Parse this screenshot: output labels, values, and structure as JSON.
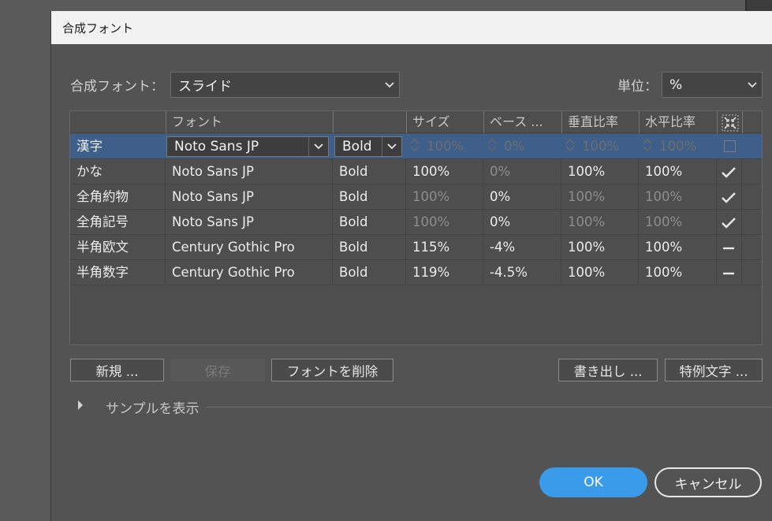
{
  "dialog": {
    "title": "合成フォント"
  },
  "composite": {
    "label": "合成フォント：",
    "value": "スライド"
  },
  "unit": {
    "label": "単位：",
    "value": "%"
  },
  "table": {
    "headers": {
      "font": "フォント",
      "size": "サイズ",
      "baseline": "ベース ...",
      "vscale": "垂直比率",
      "hscale": "水平比率"
    },
    "rows": [
      {
        "name": "漢字",
        "font": "Noto Sans JP",
        "style": "Bold",
        "size": "100%",
        "baseline": "0%",
        "vscale": "100%",
        "hscale": "100%",
        "mark": "checkbox"
      },
      {
        "name": "かな",
        "font": "Noto Sans JP",
        "style": "Bold",
        "size": "100%",
        "baseline": "0%",
        "vscale": "100%",
        "hscale": "100%",
        "mark": "check"
      },
      {
        "name": "全角約物",
        "font": "Noto Sans JP",
        "style": "Bold",
        "size": "100%",
        "baseline": "0%",
        "vscale": "100%",
        "hscale": "100%",
        "mark": "check"
      },
      {
        "name": "全角記号",
        "font": "Noto Sans JP",
        "style": "Bold",
        "size": "100%",
        "baseline": "0%",
        "vscale": "100%",
        "hscale": "100%",
        "mark": "check"
      },
      {
        "name": "半角欧文",
        "font": "Century Gothic Pro",
        "style": "Bold",
        "size": "115%",
        "baseline": "-4%",
        "vscale": "100%",
        "hscale": "100%",
        "mark": "dash"
      },
      {
        "name": "半角数字",
        "font": "Century Gothic Pro",
        "style": "Bold",
        "size": "119%",
        "baseline": "-4.5%",
        "vscale": "100%",
        "hscale": "100%",
        "mark": "dash"
      }
    ]
  },
  "buttons": {
    "new": "新規 ...",
    "save": "保存",
    "delete": "フォントを削除",
    "export": "書き出し ...",
    "exceptions": "特例文字 ...",
    "ok": "OK",
    "cancel": "キャンセル"
  },
  "sample": {
    "label": "サンプルを表示"
  },
  "colors": {
    "accent": "#3a9bea",
    "selection": "#3e5f8a",
    "dialog_bg": "#535353"
  }
}
